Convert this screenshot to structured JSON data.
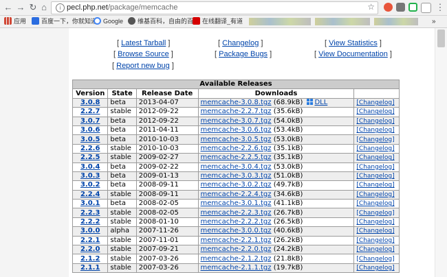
{
  "browser": {
    "url_host": "pecl.php.net",
    "url_path": "/package/memcache"
  },
  "bookmarks": [
    {
      "label": "应用",
      "color": "#d14836"
    },
    {
      "label": "百度一下，你就知道",
      "color": "#2b6de0"
    },
    {
      "label": "Google",
      "color": "#4285f4"
    },
    {
      "label": "维基百科，自由的百",
      "color": "#555555"
    },
    {
      "label": "在线翻译_有道",
      "color": "#d50000"
    }
  ],
  "links": {
    "latest_tarball": "Latest Tarball",
    "changelog": "Changelog",
    "view_statistics": "View Statistics",
    "browse_source": "Browse Source",
    "package_bugs": "Package Bugs",
    "view_documentation": "View Documentation",
    "report_new_bug": "Report new bug"
  },
  "releases": {
    "title": "Available Releases",
    "headers": {
      "version": "Version",
      "state": "State",
      "date": "Release Date",
      "downloads": "Downloads"
    },
    "dll_label": "DLL",
    "changelog_label": "[Changelog]",
    "rows": [
      {
        "version": "3.0.8",
        "state": "beta",
        "date": "2013-04-07",
        "file": "memcache-3.0.8.tgz",
        "size": "(68.9kB)",
        "dll": true
      },
      {
        "version": "2.2.7",
        "state": "stable",
        "date": "2012-09-22",
        "file": "memcache-2.2.7.tgz",
        "size": "(35.6kB)"
      },
      {
        "version": "3.0.7",
        "state": "beta",
        "date": "2012-09-22",
        "file": "memcache-3.0.7.tgz",
        "size": "(54.0kB)"
      },
      {
        "version": "3.0.6",
        "state": "beta",
        "date": "2011-04-11",
        "file": "memcache-3.0.6.tgz",
        "size": "(53.4kB)"
      },
      {
        "version": "3.0.5",
        "state": "beta",
        "date": "2010-10-03",
        "file": "memcache-3.0.5.tgz",
        "size": "(53.0kB)"
      },
      {
        "version": "2.2.6",
        "state": "stable",
        "date": "2010-10-03",
        "file": "memcache-2.2.6.tgz",
        "size": "(35.1kB)"
      },
      {
        "version": "2.2.5",
        "state": "stable",
        "date": "2009-02-27",
        "file": "memcache-2.2.5.tgz",
        "size": "(35.1kB)"
      },
      {
        "version": "3.0.4",
        "state": "beta",
        "date": "2009-02-22",
        "file": "memcache-3.0.4.tgz",
        "size": "(53.0kB)"
      },
      {
        "version": "3.0.3",
        "state": "beta",
        "date": "2009-01-13",
        "file": "memcache-3.0.3.tgz",
        "size": "(51.0kB)"
      },
      {
        "version": "3.0.2",
        "state": "beta",
        "date": "2008-09-11",
        "file": "memcache-3.0.2.tgz",
        "size": "(49.7kB)"
      },
      {
        "version": "2.2.4",
        "state": "stable",
        "date": "2008-09-11",
        "file": "memcache-2.2.4.tgz",
        "size": "(34.6kB)"
      },
      {
        "version": "3.0.1",
        "state": "beta",
        "date": "2008-02-05",
        "file": "memcache-3.0.1.tgz",
        "size": "(41.1kB)"
      },
      {
        "version": "2.2.3",
        "state": "stable",
        "date": "2008-02-05",
        "file": "memcache-2.2.3.tgz",
        "size": "(26.7kB)"
      },
      {
        "version": "2.2.2",
        "state": "stable",
        "date": "2008-01-10",
        "file": "memcache-2.2.2.tgz",
        "size": "(26.5kB)"
      },
      {
        "version": "3.0.0",
        "state": "alpha",
        "date": "2007-11-26",
        "file": "memcache-3.0.0.tgz",
        "size": "(40.6kB)"
      },
      {
        "version": "2.2.1",
        "state": "stable",
        "date": "2007-11-01",
        "file": "memcache-2.2.1.tgz",
        "size": "(26.2kB)"
      },
      {
        "version": "2.2.0",
        "state": "stable",
        "date": "2007-09-21",
        "file": "memcache-2.2.0.tgz",
        "size": "(24.2kB)"
      },
      {
        "version": "2.1.2",
        "state": "stable",
        "date": "2007-03-26",
        "file": "memcache-2.1.2.tgz",
        "size": "(21.8kB)"
      },
      {
        "version": "2.1.1",
        "state": "stable",
        "date": "2007-03-26",
        "file": "memcache-2.1.1.tgz",
        "size": "(19.7kB)"
      }
    ]
  }
}
